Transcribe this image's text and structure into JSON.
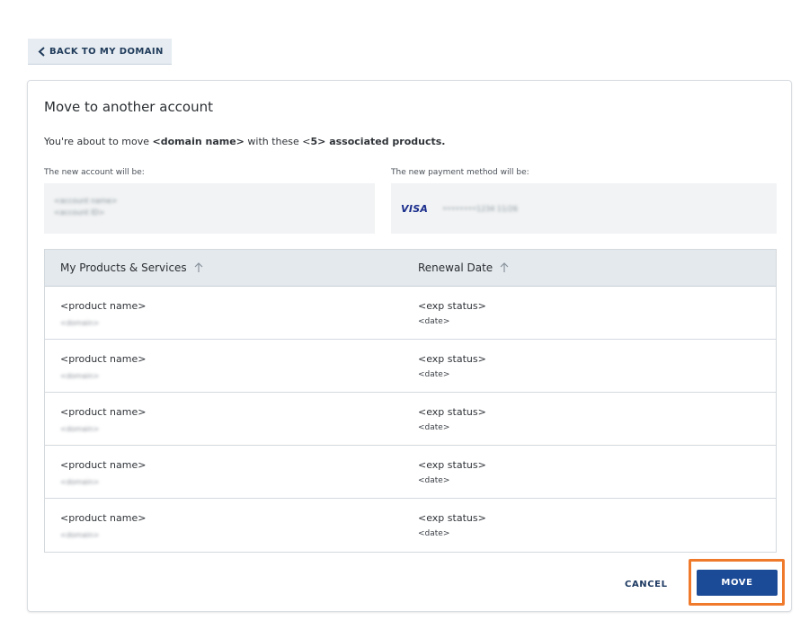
{
  "back_label": "BACK TO MY DOMAIN",
  "title": "Move to another account",
  "intro": {
    "prefix": "You're about to move ",
    "domain": "<domain name>",
    "middle": " with these <",
    "count": "5",
    "suffix": "> associated products."
  },
  "new_account_label": "The new account will be:",
  "new_payment_label": "The new payment method will be:",
  "account": {
    "name": "<account name>",
    "id": "<account ID>"
  },
  "payment": {
    "brand": "VISA",
    "masked": "••••••••1234  11/26"
  },
  "table": {
    "col_products": "My Products & Services",
    "col_renewal": "Renewal Date",
    "rows": [
      {
        "product": "<product name>",
        "domain": "<domain>",
        "status": "<exp status>",
        "date": "<date>"
      },
      {
        "product": "<product name>",
        "domain": "<domain>",
        "status": "<exp status>",
        "date": "<date>"
      },
      {
        "product": "<product name>",
        "domain": "<domain>",
        "status": "<exp status>",
        "date": "<date>"
      },
      {
        "product": "<product name>",
        "domain": "<domain>",
        "status": "<exp status>",
        "date": "<date>"
      },
      {
        "product": "<product name>",
        "domain": "<domain>",
        "status": "<exp status>",
        "date": "<date>"
      }
    ]
  },
  "cancel_label": "CANCEL",
  "move_label": "MOVE",
  "colors": {
    "primary": "#1b4a97",
    "highlight": "#f07a2c",
    "header_bg": "#e4e9ee"
  }
}
